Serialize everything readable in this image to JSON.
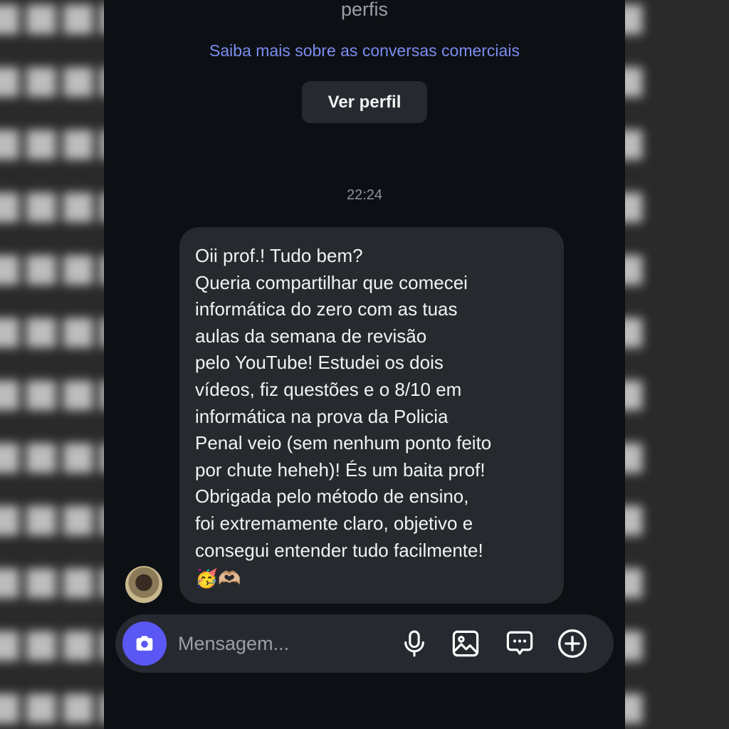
{
  "header": {
    "top_text": "perfis",
    "learn_more_link": "Saiba mais sobre as conversas comerciais",
    "view_profile_button": "Ver perfil"
  },
  "thread": {
    "timestamp": "22:24",
    "message": {
      "lines": [
        "Oii prof.! Tudo bem?",
        "Queria compartilhar que comecei",
        "informática do zero com as tuas",
        "aulas da semana de revisão",
        "pelo YouTube! Estudei os dois",
        "vídeos, fiz questões e o 8/10 em",
        "informática na prova da Policia",
        "Penal veio (sem nenhum ponto feito",
        "por chute heheh)! És um baita prof!",
        "Obrigada pelo método de ensino,",
        "foi extremamente claro, objetivo e",
        "consegui entender tudo facilmente!"
      ],
      "emojis": "🥳🫶🏼"
    }
  },
  "composer": {
    "placeholder": "Mensagem...",
    "icons": [
      "camera-icon",
      "microphone-icon",
      "gallery-icon",
      "sticker-chat-icon",
      "add-icon"
    ]
  },
  "colors": {
    "screen_bg": "#0c1014",
    "bubble_bg": "#262a2f",
    "link": "#7b8cf0",
    "camera_accent": "#5b57f5"
  }
}
